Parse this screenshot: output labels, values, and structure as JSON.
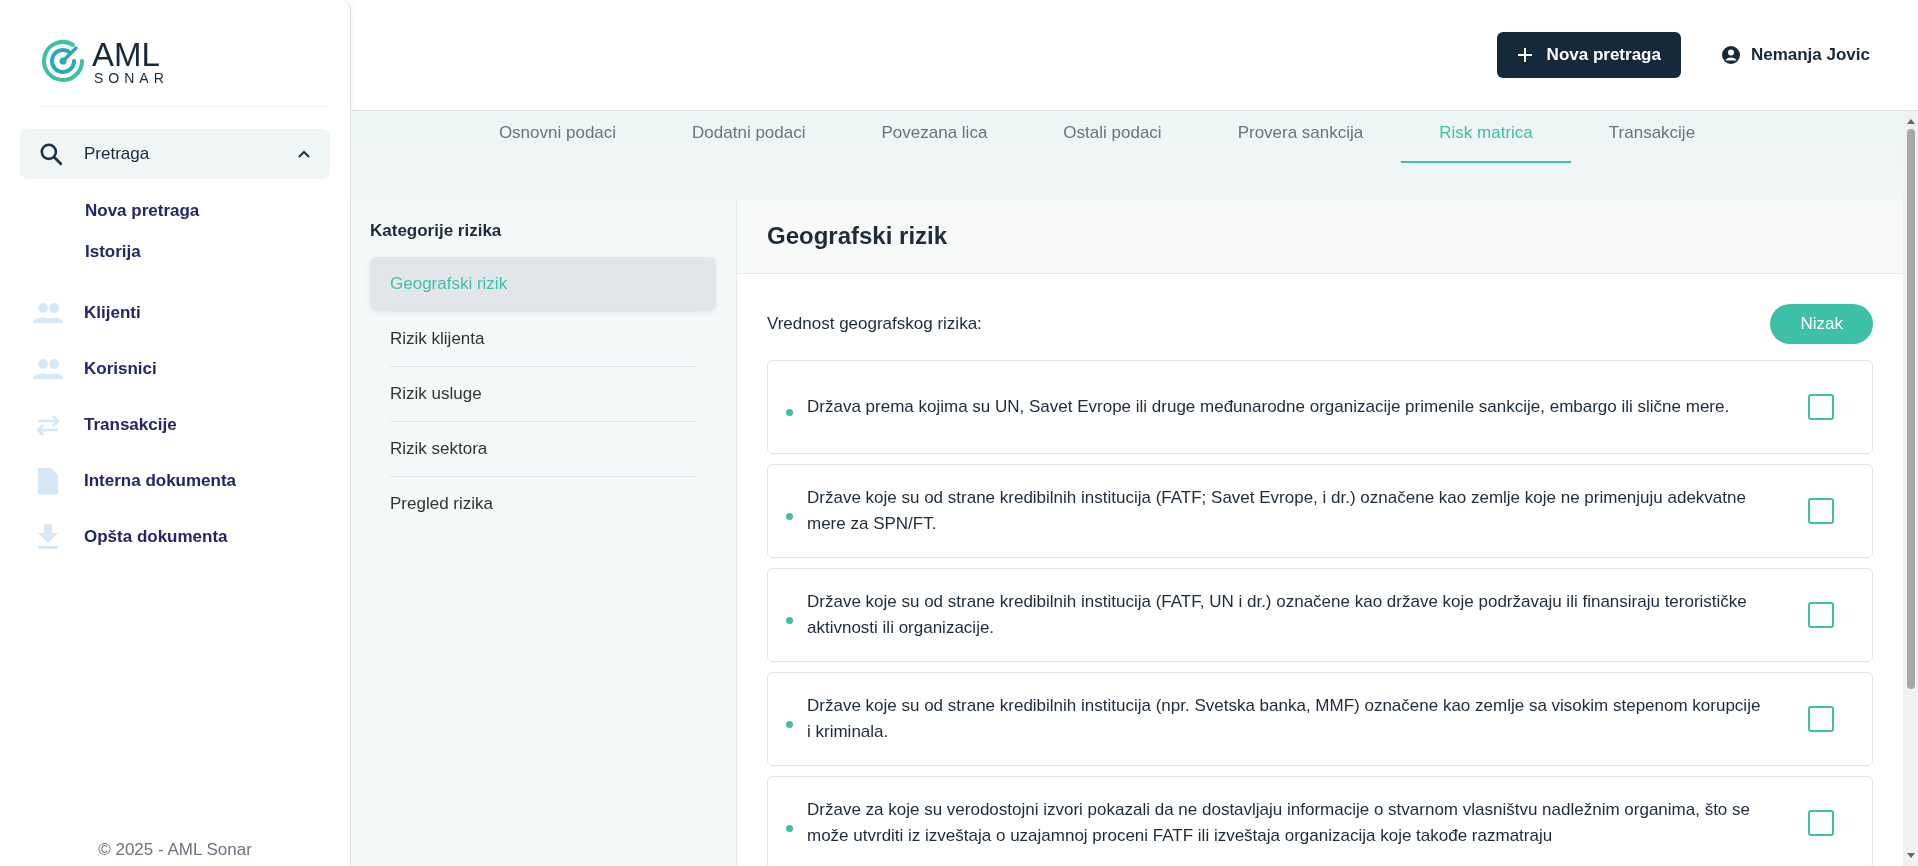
{
  "logo": {
    "name": "AML",
    "sub": "SONAR"
  },
  "sidebar": {
    "group": {
      "label": "Pretraga",
      "expanded": true,
      "children": [
        {
          "label": "Nova pretraga"
        },
        {
          "label": "Istorija"
        }
      ]
    },
    "items": [
      {
        "label": "Klijenti"
      },
      {
        "label": "Korisnici"
      },
      {
        "label": "Transakcije"
      },
      {
        "label": "Interna dokumenta"
      },
      {
        "label": "Opšta dokumenta"
      }
    ],
    "footer": "© 2025 - AML Sonar"
  },
  "topbar": {
    "new_button": "Nova pretraga",
    "user": "Nemanja Jovic"
  },
  "tabs": [
    {
      "label": "Osnovni podaci",
      "selected": false
    },
    {
      "label": "Dodatni podaci",
      "selected": false
    },
    {
      "label": "Povezana lica",
      "selected": false
    },
    {
      "label": "Ostali podaci",
      "selected": false
    },
    {
      "label": "Provera sankcija",
      "selected": false
    },
    {
      "label": "Risk matrica",
      "selected": true
    },
    {
      "label": "Transakcije",
      "selected": false
    }
  ],
  "categories": {
    "title": "Kategorije rizika",
    "items": [
      {
        "label": "Geografski rizik",
        "selected": true
      },
      {
        "label": "Rizik klijenta",
        "selected": false
      },
      {
        "label": "Rizik usluge",
        "selected": false
      },
      {
        "label": "Rizik sektora",
        "selected": false
      },
      {
        "label": "Pregled rizika",
        "selected": false
      }
    ]
  },
  "panel": {
    "title": "Geografski rizik",
    "value_label": "Vrednost geografskog rizika:",
    "value": "Nizak",
    "criteria": [
      {
        "text": "Država prema kojima su UN, Savet Evrope ili druge međunarodne organizacije primenile sankcije, embargo ili slične mere.",
        "checked": false
      },
      {
        "text": "Države koje su od strane kredibilnih institucija (FATF; Savet Evrope, i dr.) označene kao zemlje koje ne primenjuju adekvatne mere za SPN/FT.",
        "checked": false
      },
      {
        "text": "Države koje su od strane kredibilnih institucija (FATF, UN i dr.) označene kao države koje podržavaju ili finansiraju terorističke aktivnosti ili organizacije.",
        "checked": false
      },
      {
        "text": "Države koje su od strane kredibilnih institucija (npr. Svetska banka, MMF) označene kao zemlje sa visokim stepenom korupcije i kriminala.",
        "checked": false
      },
      {
        "text": "Države za koje su verodostojni izvori pokazali da ne dostavljaju informacije o stvarnom vlasništvu nadležnim organima, što se može utvrditi iz izveštaja o uzajamnoj proceni FATF ili izveštaja organizacija koje takođe razmatraju",
        "checked": false
      }
    ]
  }
}
